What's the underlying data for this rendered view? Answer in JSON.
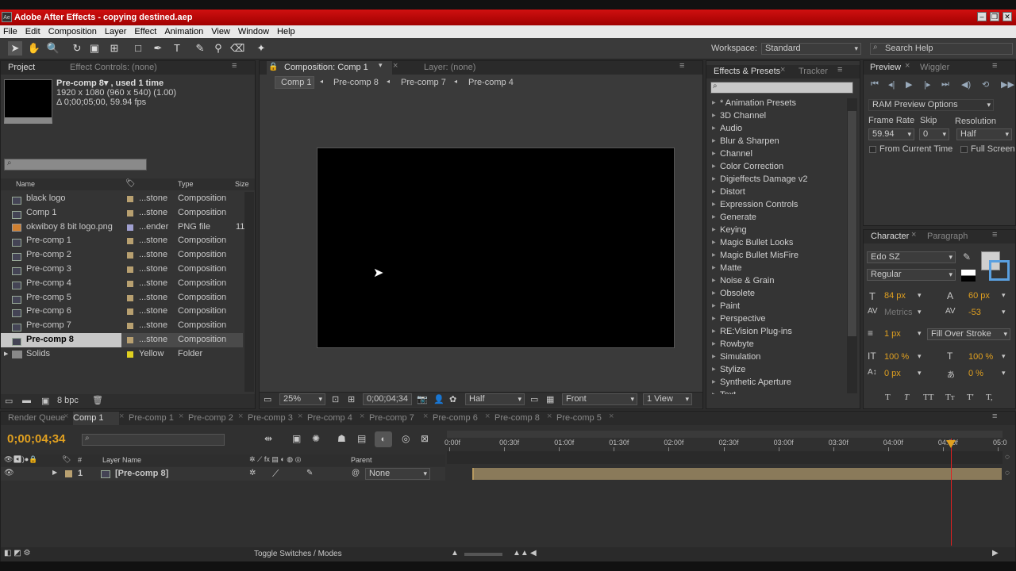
{
  "app": {
    "title": "Adobe After Effects - copying destined.aep",
    "icon": "Ae"
  },
  "menu": [
    "File",
    "Edit",
    "Composition",
    "Layer",
    "Effect",
    "Animation",
    "View",
    "Window",
    "Help"
  ],
  "workspace": {
    "label": "Workspace:",
    "value": "Standard"
  },
  "search_help": "Search Help",
  "project": {
    "tab": "Project",
    "tab2": "Effect Controls: (none)",
    "info_name": "Pre-comp 8▾ , used 1 time",
    "info_size": "1920 x 1080  (960 x 540) (1.00)",
    "info_dur": "Δ 0;00;05;00, 59.94 fps",
    "col_name": "Name",
    "col_type": "Type",
    "col_size": "Size",
    "items": [
      {
        "name": "black logo",
        "label": "...stone",
        "type": "Composition",
        "size": "",
        "color": "#b8a070",
        "icon": "comp"
      },
      {
        "name": "Comp 1",
        "label": "...stone",
        "type": "Composition",
        "size": "",
        "color": "#b8a070",
        "icon": "comp"
      },
      {
        "name": "okwiboy 8 bit logo.png",
        "label": "...ender",
        "type": "PNG file",
        "size": "11",
        "color": "#a0a0d0",
        "icon": "png"
      },
      {
        "name": "Pre-comp 1",
        "label": "...stone",
        "type": "Composition",
        "size": "",
        "color": "#b8a070",
        "icon": "comp"
      },
      {
        "name": "Pre-comp 2",
        "label": "...stone",
        "type": "Composition",
        "size": "",
        "color": "#b8a070",
        "icon": "comp"
      },
      {
        "name": "Pre-comp 3",
        "label": "...stone",
        "type": "Composition",
        "size": "",
        "color": "#b8a070",
        "icon": "comp"
      },
      {
        "name": "Pre-comp 4",
        "label": "...stone",
        "type": "Composition",
        "size": "",
        "color": "#b8a070",
        "icon": "comp"
      },
      {
        "name": "Pre-comp 5",
        "label": "...stone",
        "type": "Composition",
        "size": "",
        "color": "#b8a070",
        "icon": "comp"
      },
      {
        "name": "Pre-comp 6",
        "label": "...stone",
        "type": "Composition",
        "size": "",
        "color": "#b8a070",
        "icon": "comp"
      },
      {
        "name": "Pre-comp 7",
        "label": "...stone",
        "type": "Composition",
        "size": "",
        "color": "#b8a070",
        "icon": "comp"
      },
      {
        "name": "Pre-comp 8",
        "label": "...stone",
        "type": "Composition",
        "size": "",
        "color": "#b8a070",
        "icon": "comp",
        "selected": true
      },
      {
        "name": "Solids",
        "label": "Yellow",
        "type": "Folder",
        "size": "",
        "color": "#e0d020",
        "icon": "folder"
      }
    ],
    "bpc": "8 bpc"
  },
  "composition": {
    "tab": "Composition: Comp 1",
    "layer_tab": "Layer: (none)",
    "crumbs": [
      "Comp 1",
      "Pre-comp 8",
      "Pre-comp 7",
      "Pre-comp 4"
    ],
    "zoom": "25%",
    "timecode": "0;00;04;34",
    "resolution": "Half",
    "view": "Front",
    "views": "1 View"
  },
  "effects": {
    "tab": "Effects & Presets",
    "tab2": "Tracker",
    "items": [
      "* Animation Presets",
      "3D Channel",
      "Audio",
      "Blur & Sharpen",
      "Channel",
      "Color Correction",
      "Digieffects Damage v2",
      "Distort",
      "Expression Controls",
      "Generate",
      "Keying",
      "Magic Bullet Looks",
      "Magic Bullet MisFire",
      "Matte",
      "Noise & Grain",
      "Obsolete",
      "Paint",
      "Perspective",
      "RE:Vision Plug-ins",
      "Rowbyte",
      "Simulation",
      "Stylize",
      "Synthetic Aperture",
      "Text"
    ]
  },
  "preview": {
    "tab": "Preview",
    "tab2": "Wiggler",
    "ram": "RAM Preview Options",
    "frame_rate_label": "Frame Rate",
    "skip_label": "Skip",
    "resolution_label": "Resolution",
    "frame_rate": "59.94",
    "skip": "0",
    "resolution": "Half",
    "from_current": "From Current Time",
    "full_screen": "Full Screen"
  },
  "character": {
    "tab": "Character",
    "tab2": "Paragraph",
    "font": "Edo SZ",
    "style": "Regular",
    "size": "84 px",
    "leading": "60 px",
    "kerning": "Metrics",
    "tracking": "-53",
    "stroke": "1 px",
    "stroke_mode": "Fill Over Stroke",
    "vscale": "100 %",
    "hscale": "100 %",
    "baseline": "0 px",
    "tsume": "0 %",
    "styles": [
      "T",
      "T",
      "TT",
      "Tт",
      "T'",
      "T,"
    ]
  },
  "timeline": {
    "tabs": [
      "Render Queue",
      "Comp 1",
      "Pre-comp 1",
      "Pre-comp 2",
      "Pre-comp 3",
      "Pre-comp 4",
      "Pre-comp 7",
      "Pre-comp 6",
      "Pre-comp 8",
      "Pre-comp 5"
    ],
    "timecode": "0;00;04;34",
    "col_layer": "Layer Name",
    "col_parent": "Parent",
    "hash": "#",
    "ticks": [
      "0:00f",
      "00:30f",
      "01:00f",
      "01:30f",
      "02:00f",
      "02:30f",
      "03:00f",
      "03:30f",
      "04:00f",
      "04:30f",
      "05:0"
    ],
    "layer": {
      "num": "1",
      "name": "[Pre-comp 8]",
      "parent": "None"
    },
    "toggle": "Toggle Switches / Modes",
    "playhead_seconds": 4.57,
    "duration_seconds": 5
  }
}
